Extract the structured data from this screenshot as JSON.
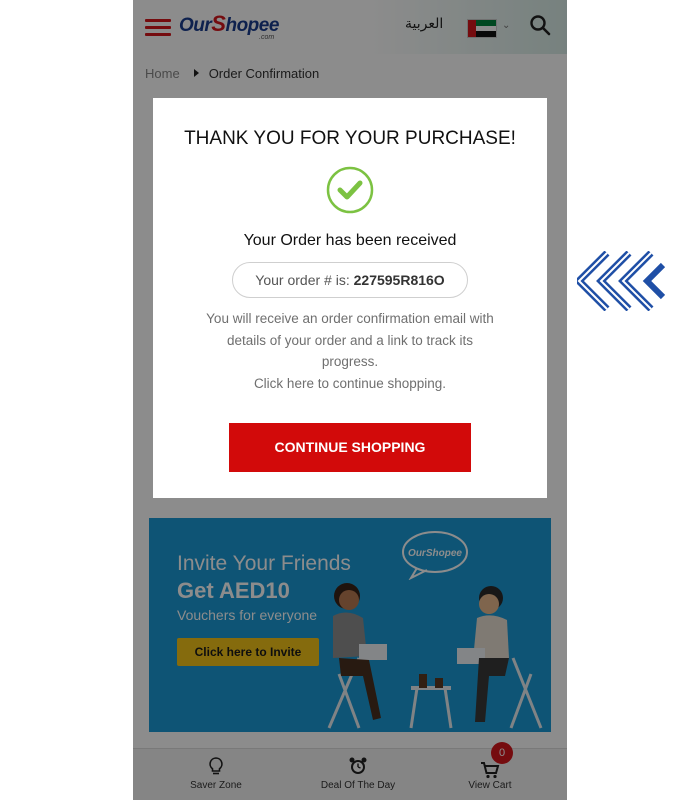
{
  "header": {
    "logo_part1": "Our",
    "logo_part2": "S",
    "logo_part3": "hopee",
    "logo_suffix": ".com",
    "language": "العربية",
    "icons": {
      "menu": "hamburger-menu-icon",
      "flag": "uae-flag-icon",
      "search": "search-icon"
    }
  },
  "breadcrumb": {
    "home": "Home",
    "current": "Order Confirmation"
  },
  "modal": {
    "title": "THANK YOU FOR YOUR PURCHASE!",
    "received": "Your Order has been received",
    "order_label": "Your order # is:",
    "order_number": "227595R816O",
    "message_line1": "You will receive an order confirmation email with",
    "message_line2": "details of your order and a link to track its",
    "message_line3": "progress.",
    "message_line4": "Click here to continue shopping.",
    "continue_button": "CONTINUE SHOPPING"
  },
  "banner": {
    "line1": "Invite Your Friends",
    "line2": "Get AED10",
    "line3": "Vouchers for everyone",
    "button": "Click here to Invite",
    "bubble_logo": "OurShopee"
  },
  "bottom_nav": {
    "items": [
      {
        "label": "Saver Zone",
        "icon": "lightbulb-icon"
      },
      {
        "label": "Deal Of The Day",
        "icon": "alarm-clock-icon"
      },
      {
        "label": "View Cart",
        "icon": "cart-icon"
      }
    ],
    "cart_count": "0"
  },
  "colors": {
    "brand_red": "#d20a0a",
    "brand_blue": "#1a3d8f",
    "check_green": "#7cc242",
    "banner_blue": "#1a9ad6",
    "banner_button": "#f2c318",
    "arrows_blue": "#1f4fa6"
  }
}
